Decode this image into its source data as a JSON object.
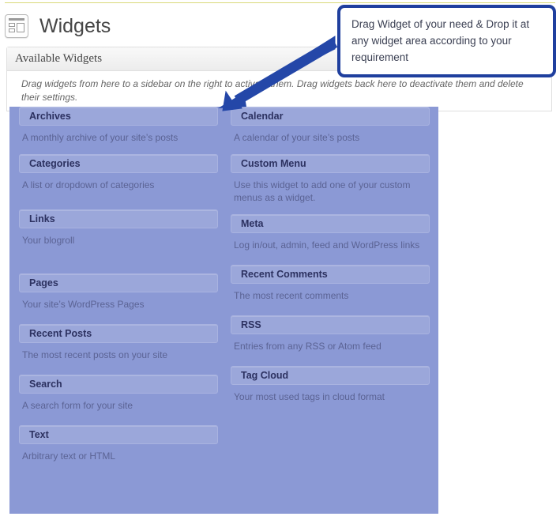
{
  "header": {
    "title": "Widgets",
    "icon": "widgets-icon"
  },
  "panel": {
    "heading": "Available Widgets",
    "description": "Drag widgets from here to a sidebar on the right to activate them. Drag widgets back here to deactivate them and delete their settings."
  },
  "callout": {
    "text": "Drag Widget of your need & Drop it at any widget area according to your requirement",
    "border_color": "#1f3f9e",
    "arrow_color": "#2447a8"
  },
  "colors": {
    "widget_area_bg": "#8b99d5",
    "widget_title_bg": "#9ba7da",
    "widget_title_text": "#2c3160",
    "widget_desc_text": "#5b6394",
    "top_rule": "#d9d97a"
  },
  "widgets": {
    "left": [
      {
        "title": "Archives",
        "description": "A monthly archive of your site’s posts"
      },
      {
        "title": "Categories",
        "description": "A list or dropdown of categories"
      },
      {
        "title": "Links",
        "description": "Your blogroll"
      },
      {
        "title": "Pages",
        "description": "Your site’s WordPress Pages"
      },
      {
        "title": "Recent Posts",
        "description": "The most recent posts on your site"
      },
      {
        "title": "Search",
        "description": "A search form for your site"
      },
      {
        "title": "Text",
        "description": "Arbitrary text or HTML"
      }
    ],
    "right": [
      {
        "title": "Calendar",
        "description": "A calendar of your site’s posts"
      },
      {
        "title": "Custom Menu",
        "description": "Use this widget to add one of your custom menus as a widget."
      },
      {
        "title": "Meta",
        "description": "Log in/out, admin, feed and WordPress links"
      },
      {
        "title": "Recent Comments",
        "description": "The most recent comments"
      },
      {
        "title": "RSS",
        "description": "Entries from any RSS or Atom feed"
      },
      {
        "title": "Tag Cloud",
        "description": "Your most used tags in cloud format"
      }
    ]
  }
}
